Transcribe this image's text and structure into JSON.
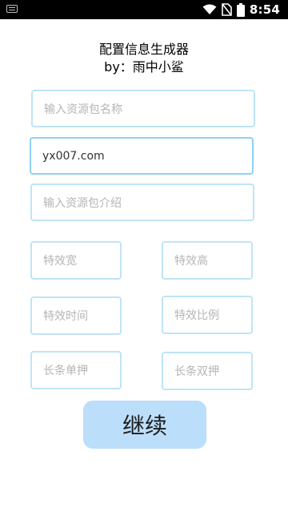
{
  "status_bar": {
    "time": "8:54",
    "icons": [
      "keyboard-icon",
      "wifi-icon",
      "no-sim-icon",
      "battery-icon"
    ]
  },
  "header": {
    "title": "配置信息生成器",
    "subtitle": "by：雨中小鲨"
  },
  "form": {
    "resource_name": {
      "placeholder": "输入资源包名称",
      "value": ""
    },
    "website": {
      "placeholder": "",
      "value": "yx007.com"
    },
    "resource_intro": {
      "placeholder": "输入资源包介绍",
      "value": ""
    },
    "effect_width": {
      "placeholder": "特效宽",
      "value": ""
    },
    "effect_height": {
      "placeholder": "特效高",
      "value": ""
    },
    "effect_time": {
      "placeholder": "特效时间",
      "value": ""
    },
    "effect_ratio": {
      "placeholder": "特效比例",
      "value": ""
    },
    "long_single": {
      "placeholder": "长条单押",
      "value": ""
    },
    "long_double": {
      "placeholder": "长条双押",
      "value": ""
    }
  },
  "actions": {
    "continue_label": "继续"
  },
  "colors": {
    "field_border": "#bfe4f7",
    "button_bg": "#bbdefb"
  }
}
